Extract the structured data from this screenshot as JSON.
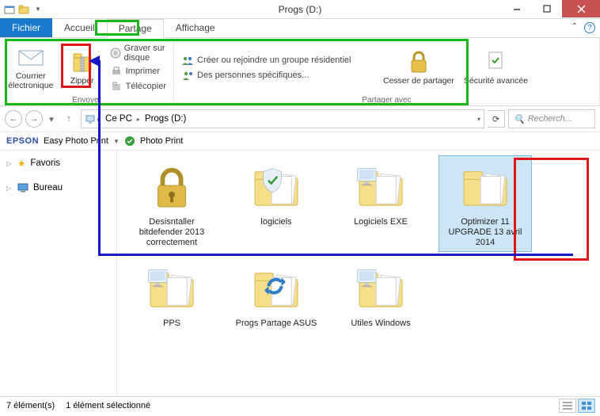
{
  "window": {
    "title": "Progs (D:)"
  },
  "tabs": {
    "file": "Fichier",
    "home": "Accueil",
    "share": "Partage",
    "view": "Affichage"
  },
  "ribbon": {
    "send": {
      "label": "Envoyer",
      "email": "Courrier électronique",
      "zip": "Zipper",
      "burn": "Graver sur disque",
      "print": "Imprimer",
      "fax": "Télécopier"
    },
    "share_with": {
      "label": "Partager avec",
      "homegroup": "Créer ou rejoindre un groupe résidentiel",
      "specific": "Des personnes spécifiques...",
      "stop": "Cesser de partager",
      "advanced": "Sécurité avancée"
    }
  },
  "breadcrumb": {
    "pc": "Ce PC",
    "drive": "Progs (D:)"
  },
  "search": {
    "placeholder": "Recherch..."
  },
  "epson": {
    "logo": "EPSON",
    "easy": "Easy Photo Print",
    "photo": "Photo Print"
  },
  "nav": {
    "favorites": "Favoris",
    "desktop": "Bureau"
  },
  "items": [
    {
      "name": "Desisntaller bitdefender 2013 correctement",
      "type": "lock",
      "selected": false
    },
    {
      "name": "logiciels",
      "type": "folder-check",
      "selected": false
    },
    {
      "name": "Logiciels EXE",
      "type": "folder-pc",
      "selected": false
    },
    {
      "name": "Optimizer 11 UPGRADE 13 avril 2014",
      "type": "folder",
      "selected": true
    },
    {
      "name": "PPS",
      "type": "folder-pc",
      "selected": false
    },
    {
      "name": "Progs Partage ASUS",
      "type": "folder-sync",
      "selected": false
    },
    {
      "name": "Utiles Windows",
      "type": "folder-pc",
      "selected": false
    }
  ],
  "status": {
    "count": "7 élément(s)",
    "selection": "1 élément sélectionné"
  }
}
